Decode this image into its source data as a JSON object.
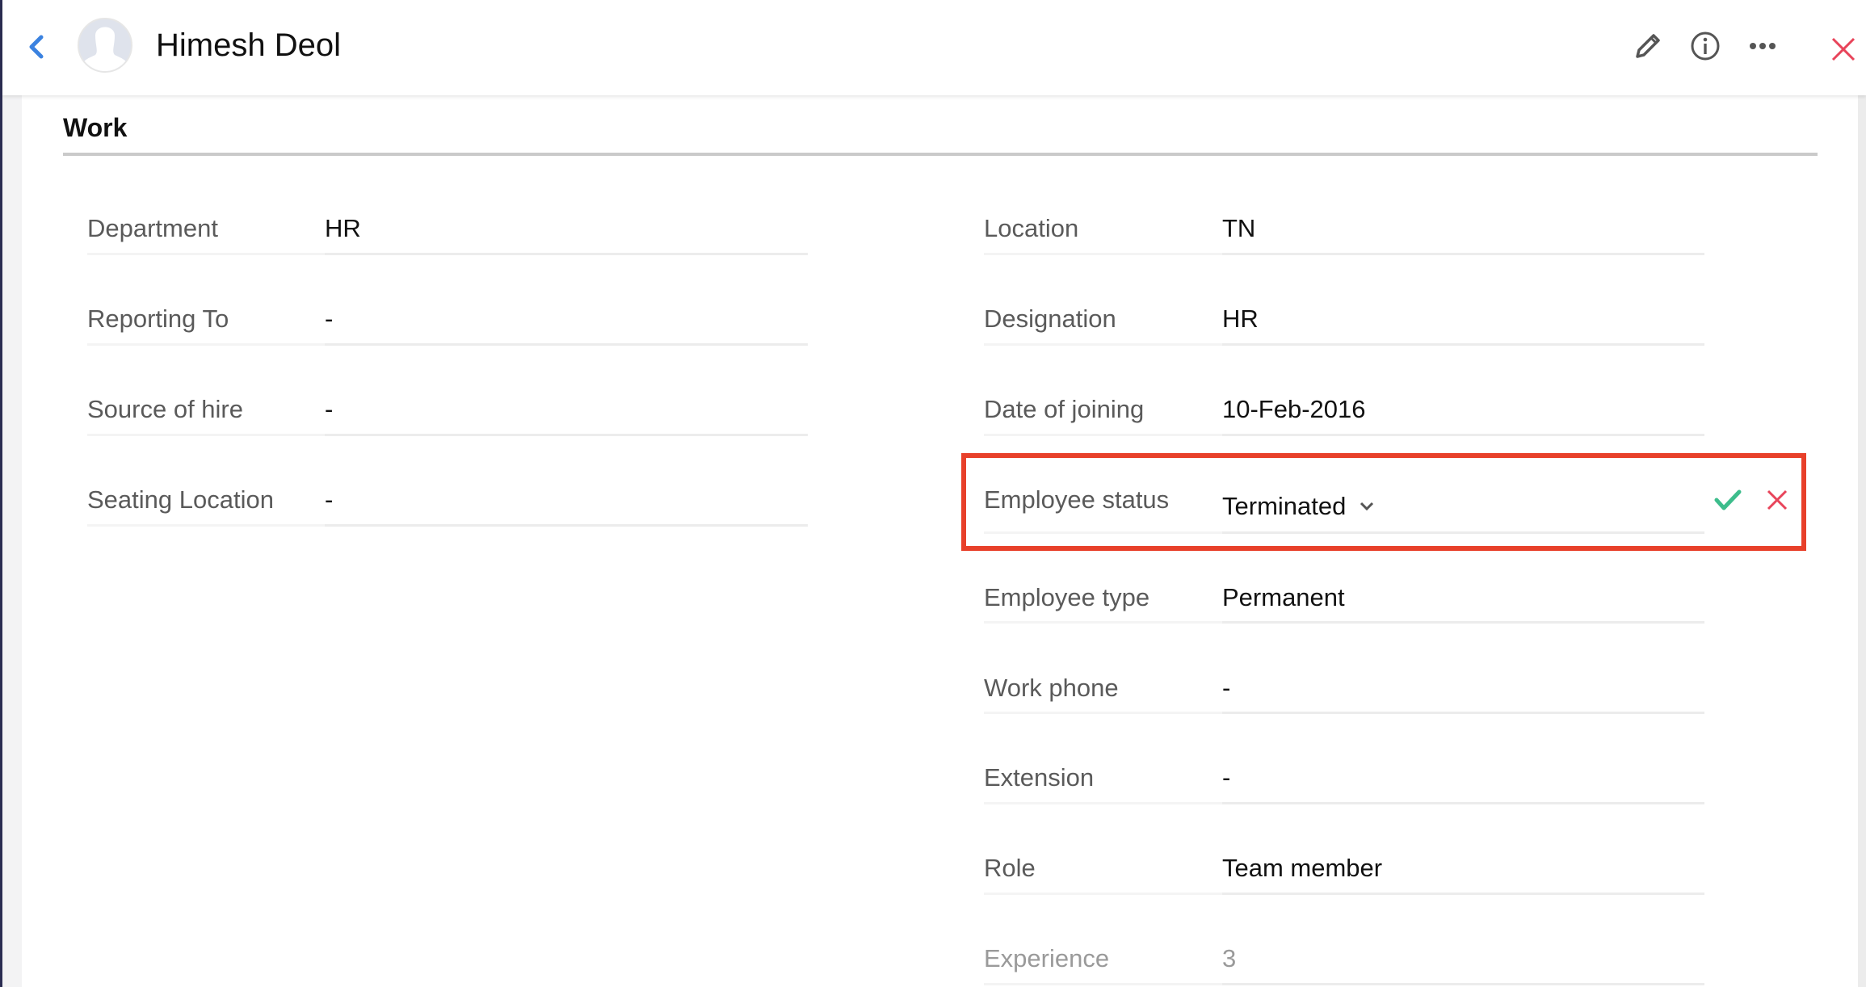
{
  "header": {
    "back_icon": "chevron-left-icon",
    "avatar_icon": "user-silhouette-icon",
    "employee_name": "Himesh Deol",
    "actions": [
      {
        "name": "edit",
        "icon": "pencil-icon"
      },
      {
        "name": "info",
        "icon": "info-icon"
      },
      {
        "name": "more",
        "icon": "more-horizontal-icon"
      },
      {
        "name": "close",
        "icon": "close-icon"
      }
    ]
  },
  "colors": {
    "accent_blue": "#3b82e0",
    "close_red": "#e8445a",
    "highlight_red": "#e8402a",
    "confirm_green": "#3dbd8c"
  },
  "section": {
    "title": "Work",
    "left_fields": [
      {
        "label": "Department",
        "value": "HR"
      },
      {
        "label": "Reporting To",
        "value": "-"
      },
      {
        "label": "Source of hire",
        "value": "-"
      },
      {
        "label": "Seating Location",
        "value": "-"
      }
    ],
    "right_fields": [
      {
        "label": "Location",
        "value": "TN"
      },
      {
        "label": "Designation",
        "value": "HR"
      },
      {
        "label": "Date of joining",
        "value": "10-Feb-2016"
      },
      {
        "label": "Employee status",
        "value": "Terminated",
        "editing": true
      },
      {
        "label": "Employee type",
        "value": "Permanent"
      },
      {
        "label": "Work phone",
        "value": "-"
      },
      {
        "label": "Extension",
        "value": "-"
      },
      {
        "label": "Role",
        "value": "Team member"
      },
      {
        "label": "Experience",
        "value": "3"
      }
    ]
  },
  "edit_actions": {
    "confirm_icon": "check-icon",
    "cancel_icon": "close-icon"
  }
}
